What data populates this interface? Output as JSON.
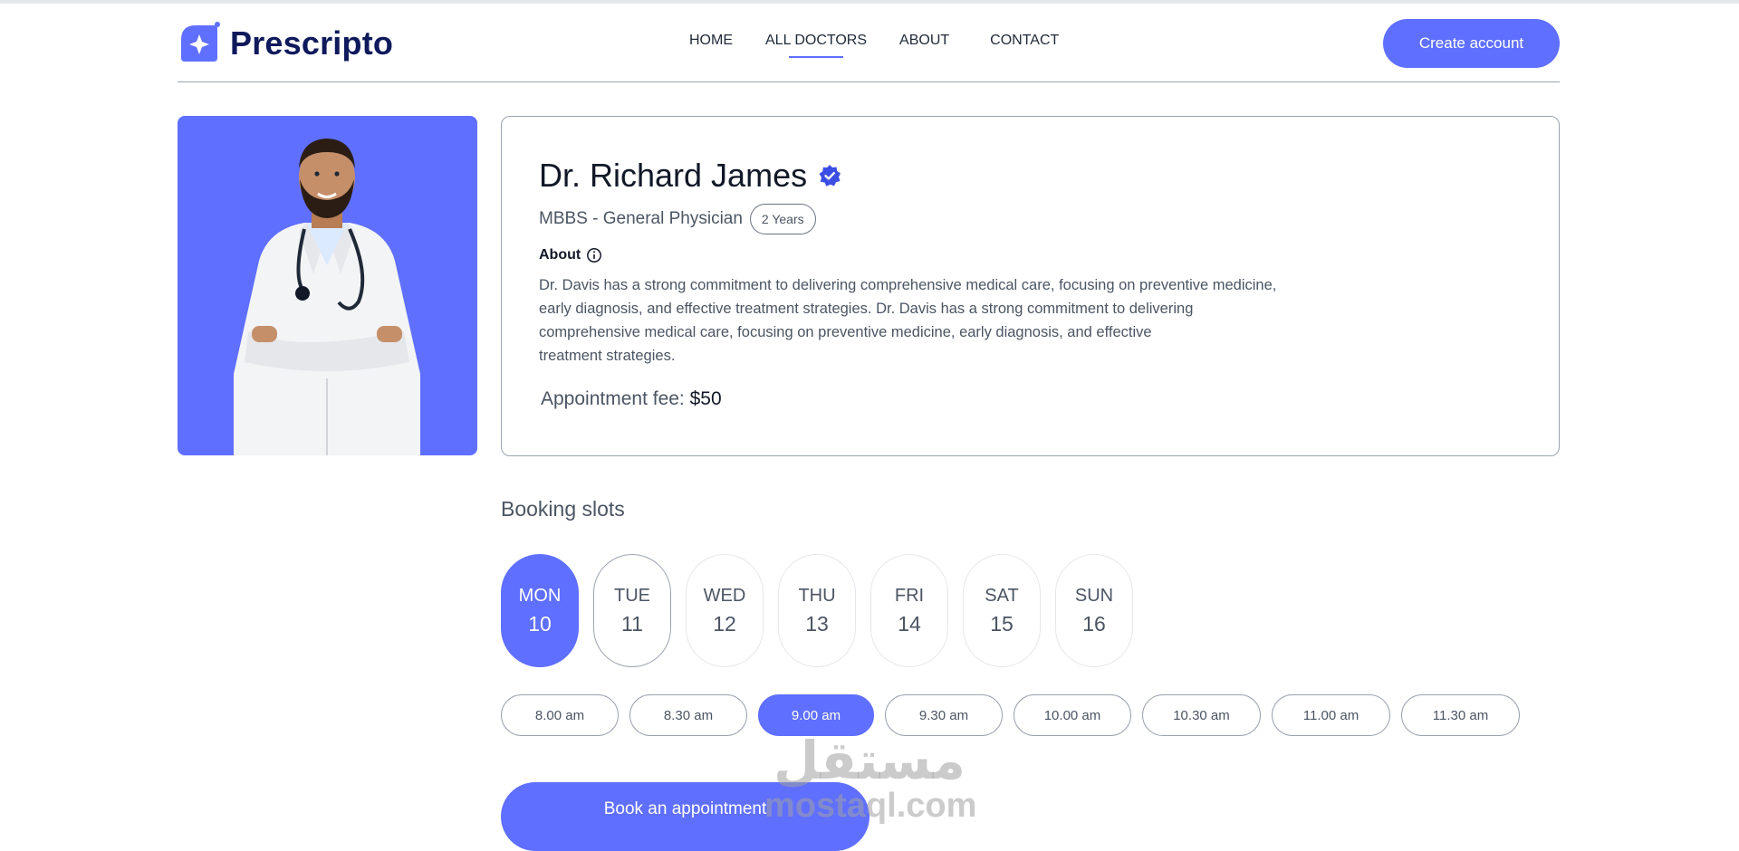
{
  "brand": {
    "name": "Prescripto",
    "accent": "#5f6fff",
    "navy": "#0f1a5c"
  },
  "nav": {
    "links": [
      {
        "label": "HOME"
      },
      {
        "label": "ALL DOCTORS",
        "active": true
      },
      {
        "label": "ABOUT"
      },
      {
        "label": "CONTACT"
      }
    ],
    "cta_label": "Create account"
  },
  "doctor": {
    "name": "Dr. Richard James",
    "specialty": "MBBS - General Physician",
    "experience": "2 Years",
    "about_label": "About",
    "about_text": "Dr. Davis has a strong commitment to delivering comprehensive medical care, focusing on preventive medicine,\nearly diagnosis, and effective treatment strategies. Dr. Davis has a strong commitment to delivering\ncomprehensive medical care, focusing on preventive medicine, early diagnosis, and effective\ntreatment strategies.",
    "fee_label": "Appointment fee:",
    "fee_value": "$50"
  },
  "booking": {
    "title": "Booking slots",
    "days": [
      {
        "name": "MON",
        "date": "10",
        "selected": true
      },
      {
        "name": "TUE",
        "date": "11",
        "outlined": true
      },
      {
        "name": "WED",
        "date": "12"
      },
      {
        "name": "THU",
        "date": "13"
      },
      {
        "name": "FRI",
        "date": "14"
      },
      {
        "name": "SAT",
        "date": "15"
      },
      {
        "name": "SUN",
        "date": "16"
      }
    ],
    "times": [
      "8.00 am",
      "8.30 am",
      "9.00 am",
      "9.30 am",
      "10.00 am",
      "10.30 am",
      "11.00 am",
      "11.30 am"
    ],
    "selected_time": "9.00 am",
    "book_label": "Book an appointment"
  },
  "watermark": {
    "arabic": "مستقل",
    "latin": "mostaql.com"
  }
}
